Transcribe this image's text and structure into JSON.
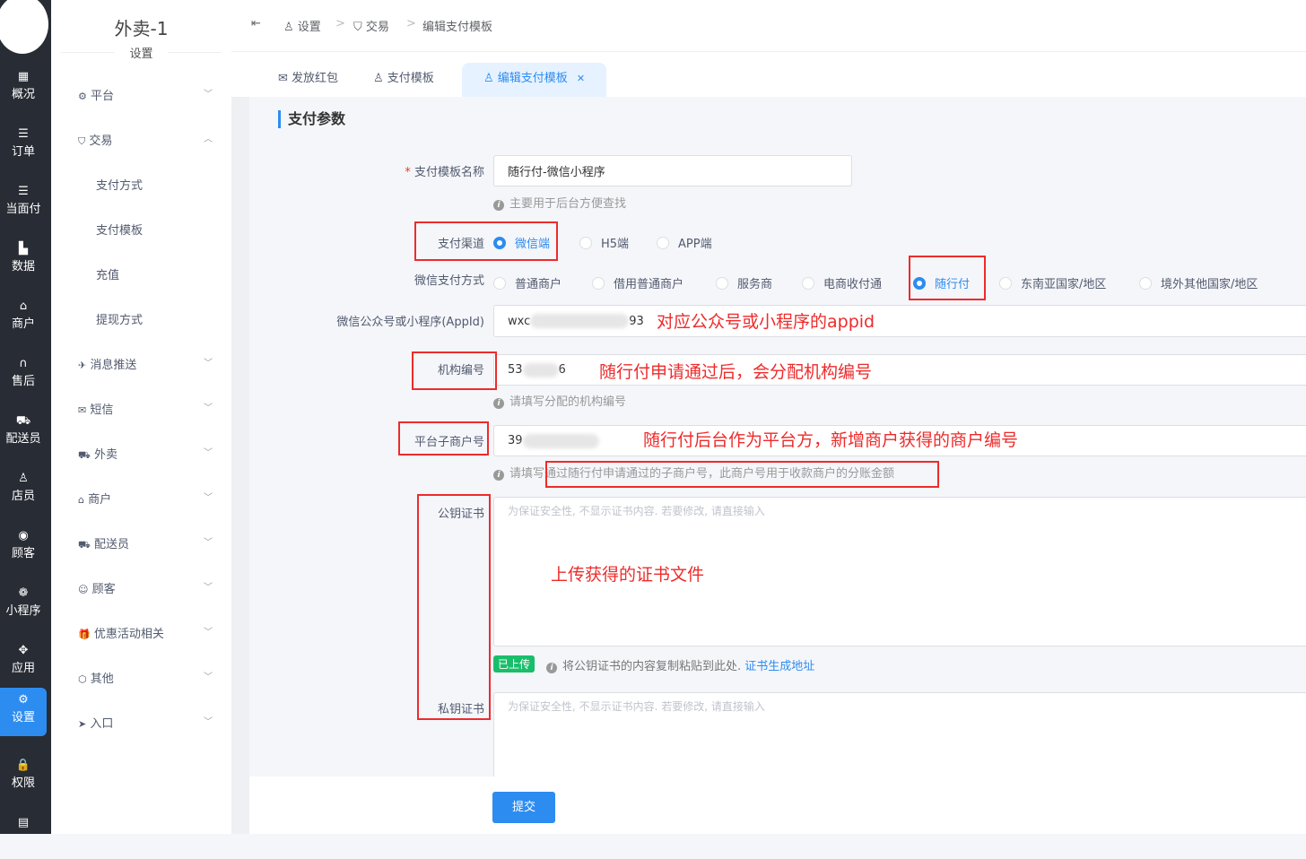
{
  "rail": {
    "items": [
      {
        "label": "概况",
        "icon": "dashboard-icon",
        "glyph": "▦"
      },
      {
        "label": "订单",
        "icon": "list-icon",
        "glyph": "☰"
      },
      {
        "label": "当面付",
        "icon": "list-icon",
        "glyph": "☰"
      },
      {
        "label": "数据",
        "icon": "bar-chart-icon",
        "glyph": "▙"
      },
      {
        "label": "商户",
        "icon": "store-icon",
        "glyph": "⌂"
      },
      {
        "label": "售后",
        "icon": "headset-icon",
        "glyph": "∩"
      },
      {
        "label": "配送员",
        "icon": "scooter-icon",
        "glyph": "⛟"
      },
      {
        "label": "店员",
        "icon": "user-icon",
        "glyph": "♙"
      },
      {
        "label": "顾客",
        "icon": "user-circle-icon",
        "glyph": "◉"
      },
      {
        "label": "小程序",
        "icon": "wechat-icon",
        "glyph": "❁"
      },
      {
        "label": "应用",
        "icon": "apps-icon",
        "glyph": "✥"
      },
      {
        "label": "设置",
        "icon": "settings-user-icon",
        "glyph": "⚙"
      },
      {
        "label": "权限",
        "icon": "lock-icon",
        "glyph": "🔒"
      },
      {
        "label": "",
        "icon": "report-icon",
        "glyph": "▤"
      }
    ]
  },
  "menu": {
    "title": "外卖-1",
    "subtitle": "设置",
    "items": [
      {
        "label": "平台",
        "glyph": "⚙",
        "chev": "﹀"
      },
      {
        "label": "交易",
        "glyph": "⛉",
        "chev": "︿"
      },
      {
        "label": "支付方式"
      },
      {
        "label": "支付模板"
      },
      {
        "label": "充值"
      },
      {
        "label": "提现方式"
      },
      {
        "label": "消息推送",
        "glyph": "✈",
        "chev": "﹀"
      },
      {
        "label": "短信",
        "glyph": "✉",
        "chev": "﹀"
      },
      {
        "label": "外卖",
        "glyph": "⛟",
        "chev": "﹀"
      },
      {
        "label": "商户",
        "glyph": "⌂",
        "chev": "﹀"
      },
      {
        "label": "配送员",
        "glyph": "⛟",
        "chev": "﹀"
      },
      {
        "label": "顾客",
        "glyph": "☺",
        "chev": "﹀"
      },
      {
        "label": "优惠活动相关",
        "glyph": "🎁",
        "chev": "﹀"
      },
      {
        "label": "其他",
        "glyph": "⬡",
        "chev": "﹀"
      },
      {
        "label": "入口",
        "glyph": "➤",
        "chev": "﹀"
      }
    ]
  },
  "breadcrumb": [
    "设置",
    "交易",
    "编辑支付模板"
  ],
  "tabs": [
    "发放红包",
    "支付模板",
    "编辑支付模板"
  ],
  "section_title": "支付参数",
  "form": {
    "name_label": "支付模板名称",
    "name_value": "随行付-微信小程序",
    "name_hint": "主要用于后台方便查找",
    "channel_label": "支付渠道",
    "channels": [
      "微信端",
      "H5端",
      "APP端"
    ],
    "channel_selected": "微信端",
    "method_label": "微信支付方式",
    "methods": [
      "普通商户",
      "借用普通商户",
      "服务商",
      "电商收付通",
      "随行付",
      "东南亚国家/地区",
      "境外其他国家/地区"
    ],
    "method_selected": "随行付",
    "appid_label": "微信公众号或小程序(AppId)",
    "appid_prefix": "wxc",
    "appid_suffix": "93",
    "org_label": "机构编号",
    "org_prefix": "53",
    "org_suffix": "6",
    "org_hint": "请填写分配的机构编号",
    "sub_label": "平台子商户号",
    "sub_prefix": "39",
    "sub_hint": "请填写通过随行付申请通过的子商户号，此商户号用于收款商户的分账金额",
    "pub_label": "公钥证书",
    "pub_placeholder": "为保证安全性, 不显示证书内容. 若要修改, 请直接输入",
    "uploaded_tag": "已上传",
    "pub_hint": "将公钥证书的内容复制粘贴到此处.",
    "pub_link": "证书生成地址",
    "priv_label": "私钥证书",
    "priv_placeholder": "为保证安全性, 不显示证书内容. 若要修改, 请直接输入",
    "submit": "提交"
  },
  "annotations": {
    "appid": "对应公众号或小程序的appid",
    "org": "随行付申请通过后，会分配机构编号",
    "sub": "随行付后台作为平台方，新增商户获得的商户编号",
    "cert": "上传获得的证书文件"
  }
}
